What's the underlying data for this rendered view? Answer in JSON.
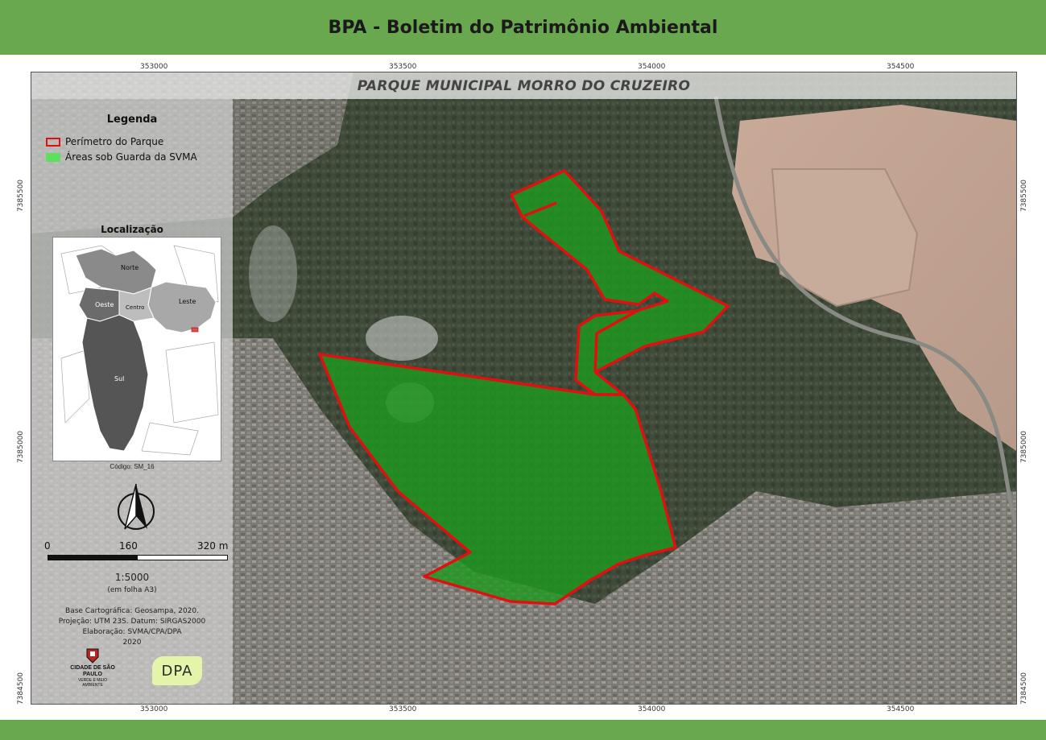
{
  "header": {
    "title": "BPA - Boletim do Patrimônio Ambiental"
  },
  "map": {
    "title": "PARQUE MUNICIPAL MORRO DO CRUZEIRO",
    "x_ticks": [
      "353000",
      "353500",
      "354000",
      "354500"
    ],
    "y_ticks": [
      "7385500",
      "7385000",
      "7384500"
    ]
  },
  "legend": {
    "title": "Legenda",
    "items": [
      {
        "label": "Perímetro do Parque",
        "color": "#e01010"
      },
      {
        "label": "Áreas sob Guarda da SVMA",
        "color": "#5ee05e"
      }
    ]
  },
  "location": {
    "title": "Localização",
    "regions": [
      "Norte",
      "Oeste",
      "Centro",
      "Leste",
      "Sul"
    ],
    "code": "Código: SM_16"
  },
  "scale": {
    "labels": [
      "0",
      "160",
      "320 m"
    ],
    "ratio": "1:5000",
    "sheet": "(em folha A3)"
  },
  "credits": {
    "line1": "Base Cartográfica: Geosampa, 2020.",
    "line2": "Projeção: UTM 23S. Datum: SIRGAS2000",
    "line3": "Elaboração: SVMA/CPA/DPA",
    "line4": "2020"
  },
  "logos": {
    "city": "CIDADE DE SÃO PAULO",
    "city_sub": "VERDE E MEIO AMBIENTE",
    "dpa": "DPA"
  },
  "colors": {
    "brand_green": "#6aa84f",
    "park_fill": "#1e9a1e",
    "perimeter": "#e01010"
  }
}
